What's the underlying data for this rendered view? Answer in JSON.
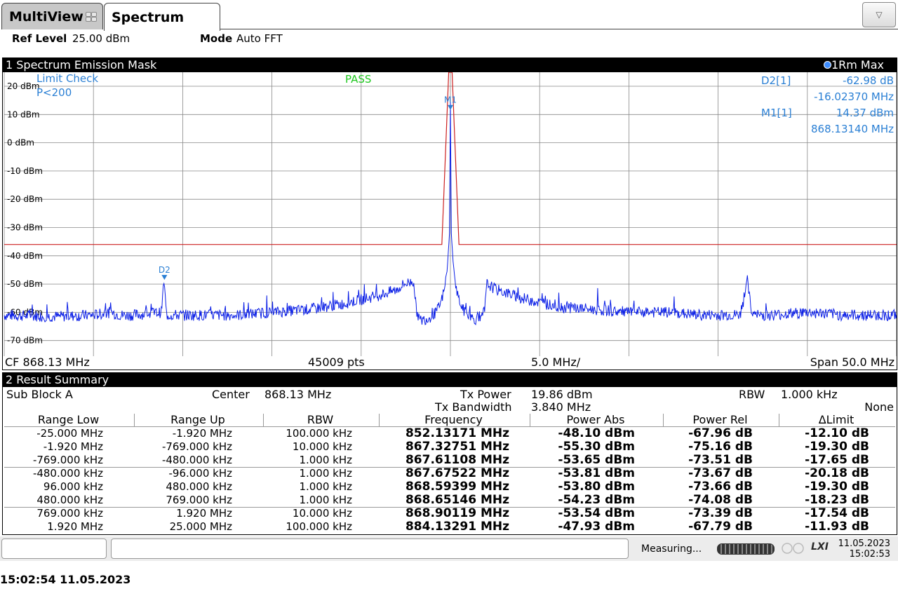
{
  "tabs": {
    "multiview": "MultiView",
    "spectrum": "Spectrum"
  },
  "header": {
    "ref_level_label": "Ref Level",
    "ref_level_value": "25.00 dBm",
    "mode_label": "Mode",
    "mode_value": "Auto FFT"
  },
  "spectrum_window": {
    "title": "1 Spectrum Emission Mask",
    "trace_label": "1Rm Max",
    "limit_check": "Limit Check",
    "limit_condition": "P<200",
    "result": "PASS",
    "marker_table": {
      "d2_label": "D2[1]",
      "d2_level": "-62.98 dB",
      "d2_freq": "-16.02370 MHz",
      "m1_label": "M1[1]",
      "m1_level": "14.37 dBm",
      "m1_freq": "868.13140 MHz"
    },
    "footer": {
      "cf": "CF 868.13 MHz",
      "points": "45009 pts",
      "div": "5.0 MHz/",
      "span": "Span 50.0 MHz"
    },
    "marker_m1_label": "M1",
    "marker_d2_label": "D2"
  },
  "chart_data": {
    "type": "line",
    "y_tick_labels": [
      "20 dBm",
      "10 dBm",
      "0 dBm",
      "-10 dBm",
      "-20 dBm",
      "-30 dBm",
      "-40 dBm",
      "-50 dBm",
      "-60 dBm",
      "-70 dBm"
    ],
    "ylim": [
      -75,
      25
    ],
    "xlim_offset_mhz": [
      -25,
      25
    ],
    "grid": true,
    "trace_color": "#0a1ee6",
    "limit_color": "#cc2020",
    "limit_line": [
      [
        -25,
        -36
      ],
      [
        -1.92,
        -36
      ],
      [
        -1.92,
        -36
      ],
      [
        -0.48,
        -36
      ],
      [
        -0.096,
        25
      ],
      [
        0.096,
        25
      ],
      [
        0.48,
        -36
      ],
      [
        1.92,
        -36
      ],
      [
        25,
        -36
      ]
    ],
    "trace_points": [
      [
        -25,
        -61
      ],
      [
        -22,
        -61.5
      ],
      [
        -20,
        -61
      ],
      [
        -19,
        -60
      ],
      [
        -18.5,
        -61
      ],
      [
        -17.8,
        -61
      ],
      [
        -16.2,
        -60
      ],
      [
        -16.05,
        -49
      ],
      [
        -15.9,
        -61
      ],
      [
        -14,
        -61
      ],
      [
        -12,
        -61
      ],
      [
        -10,
        -60
      ],
      [
        -8,
        -59
      ],
      [
        -6,
        -57
      ],
      [
        -4,
        -54
      ],
      [
        -3,
        -52
      ],
      [
        -2.6,
        -50
      ],
      [
        -2.05,
        -49
      ],
      [
        -1.92,
        -59
      ],
      [
        -1.7,
        -63
      ],
      [
        -1.2,
        -62
      ],
      [
        -0.8,
        -60
      ],
      [
        -0.55,
        -57
      ],
      [
        -0.3,
        -51
      ],
      [
        -0.15,
        -42
      ],
      [
        -0.05,
        -32
      ],
      [
        0,
        14.4
      ],
      [
        0.05,
        -32
      ],
      [
        0.15,
        -42
      ],
      [
        0.3,
        -51
      ],
      [
        0.55,
        -57
      ],
      [
        0.8,
        -60
      ],
      [
        1.2,
        -62
      ],
      [
        1.7,
        -63
      ],
      [
        1.92,
        -59
      ],
      [
        2.05,
        -50
      ],
      [
        2.6,
        -52
      ],
      [
        4,
        -55
      ],
      [
        6,
        -58
      ],
      [
        8,
        -59
      ],
      [
        10,
        -60
      ],
      [
        12,
        -60
      ],
      [
        14,
        -61
      ],
      [
        16,
        -61
      ],
      [
        16.3,
        -61
      ],
      [
        16.6,
        -48
      ],
      [
        16.9,
        -61
      ],
      [
        18,
        -61
      ],
      [
        20,
        -60
      ],
      [
        22,
        -61
      ],
      [
        25,
        -61
      ]
    ],
    "markers": [
      {
        "name": "M1",
        "x_offset_mhz": 0.0,
        "level_dbm": 14.37
      },
      {
        "name": "D2",
        "x_offset_mhz": -16.0237,
        "level_db": -62.98
      }
    ]
  },
  "result_summary": {
    "title": "2 Result Summary",
    "sub_block": "Sub Block A",
    "center_label": "Center",
    "center_value": "868.13 MHz",
    "tx_power_label": "Tx Power",
    "tx_power_value": "19.86 dBm",
    "tx_bw_label": "Tx Bandwidth",
    "tx_bw_value": "3.840 MHz",
    "rbw_label": "RBW",
    "rbw_value": "1.000 kHz",
    "none_label": "None",
    "columns": [
      "Range Low",
      "Range Up",
      "RBW",
      "Frequency",
      "Power Abs",
      "Power Rel",
      "ΔLimit"
    ],
    "rows": [
      [
        "-25.000 MHz",
        "-1.920 MHz",
        "100.000 kHz",
        "852.13171 MHz",
        "-48.10 dBm",
        "-67.96 dB",
        "-12.10 dB"
      ],
      [
        "-1.920 MHz",
        "-769.000 kHz",
        "10.000 kHz",
        "867.32751 MHz",
        "-55.30 dBm",
        "-75.16 dB",
        "-19.30 dB"
      ],
      [
        "-769.000 kHz",
        "-480.000 kHz",
        "1.000 kHz",
        "867.61108 MHz",
        "-53.65 dBm",
        "-73.51 dB",
        "-17.65 dB"
      ],
      [
        "-480.000 kHz",
        "-96.000 kHz",
        "1.000 kHz",
        "867.67522 MHz",
        "-53.81 dBm",
        "-73.67 dB",
        "-20.18 dB"
      ],
      [
        "96.000 kHz",
        "480.000 kHz",
        "1.000 kHz",
        "868.59399 MHz",
        "-53.80 dBm",
        "-73.66 dB",
        "-19.30 dB"
      ],
      [
        "480.000 kHz",
        "769.000 kHz",
        "1.000 kHz",
        "868.65146 MHz",
        "-54.23 dBm",
        "-74.08 dB",
        "-18.23 dB"
      ],
      [
        "769.000 kHz",
        "1.920 MHz",
        "10.000 kHz",
        "868.90119 MHz",
        "-53.54 dBm",
        "-73.39 dB",
        "-17.54 dB"
      ],
      [
        "1.920 MHz",
        "25.000 MHz",
        "100.000 kHz",
        "884.13291 MHz",
        "-47.93 dBm",
        "-67.79 dB",
        "-11.93 dB"
      ]
    ]
  },
  "status_bar": {
    "measuring": "Measuring...",
    "date": "11.05.2023",
    "time": "15:02:53",
    "lxi": "LXI"
  },
  "timestamp": "15:02:54  11.05.2023"
}
